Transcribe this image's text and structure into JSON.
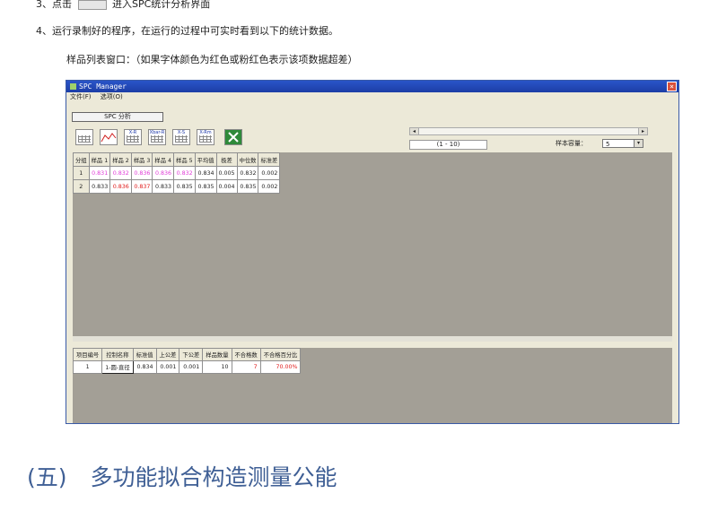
{
  "doc": {
    "line3_prefix": "3、点击",
    "line3_suffix": "进入SPC统计分析界面",
    "line4": "4、运行录制好的程序，在运行的过程中可实时看到以下的统计数据。",
    "line5": "样品列表窗口：（如果字体颜色为红色或粉红色表示该项数据超差）"
  },
  "window": {
    "title": "SPC Manager",
    "close": "×",
    "menu": [
      "文件(F)",
      "选项(O)"
    ],
    "tab": "SPC 分析",
    "tool_icons": [
      {
        "name": "table-view-icon",
        "label": ""
      },
      {
        "name": "line-chart-icon",
        "label": ""
      },
      {
        "name": "xr-chart-icon",
        "label": "X-R"
      },
      {
        "name": "xbar-r-chart-icon",
        "label": "Xbar-R"
      },
      {
        "name": "xs-chart-icon",
        "label": "X-S"
      },
      {
        "name": "x-rm-chart-icon",
        "label": "X-Rm"
      },
      {
        "name": "excel-export-icon",
        "label": ""
      }
    ],
    "scroll_left": "◂",
    "scroll_right": "▸",
    "range": "(1 - 10)",
    "sample_size_label": "样本容量：",
    "sample_size": "5",
    "dropdown": "▾"
  },
  "sample_table": {
    "headers": [
      "分组",
      "样品 1",
      "样品 2",
      "样品 3",
      "样品 4",
      "样品 5",
      "平均值",
      "极差",
      "中位数",
      "标准差"
    ],
    "rows": [
      {
        "cells": [
          "1",
          "0.831",
          "0.832",
          "0.836",
          "0.836",
          "0.832",
          "0.834",
          "0.005",
          "0.832",
          "0.002"
        ],
        "colors": [
          "",
          "pink",
          "pink",
          "pink",
          "pink",
          "pink",
          "",
          "",
          "",
          ""
        ]
      },
      {
        "cells": [
          "2",
          "0.833",
          "0.836",
          "0.837",
          "0.833",
          "0.835",
          "0.835",
          "0.004",
          "0.835",
          "0.002"
        ],
        "colors": [
          "",
          "",
          "red",
          "red",
          "",
          "",
          "",
          "",
          "",
          ""
        ]
      }
    ]
  },
  "summary_table": {
    "headers": [
      "项目编号",
      "控制名称",
      "标准值",
      "上公差",
      "下公差",
      "样品数量",
      "不合格数",
      "不合格百分比"
    ],
    "rows": [
      {
        "cells": [
          "1",
          "1-圆-直径",
          "0.834",
          "0.001",
          "0.001",
          "10",
          "7",
          "70.00%"
        ],
        "colors": [
          "",
          "",
          "",
          "",
          "",
          "",
          "red",
          "red"
        ]
      }
    ]
  },
  "heading": {
    "number": "(五)",
    "text": "多功能拟合构造测量公能"
  }
}
